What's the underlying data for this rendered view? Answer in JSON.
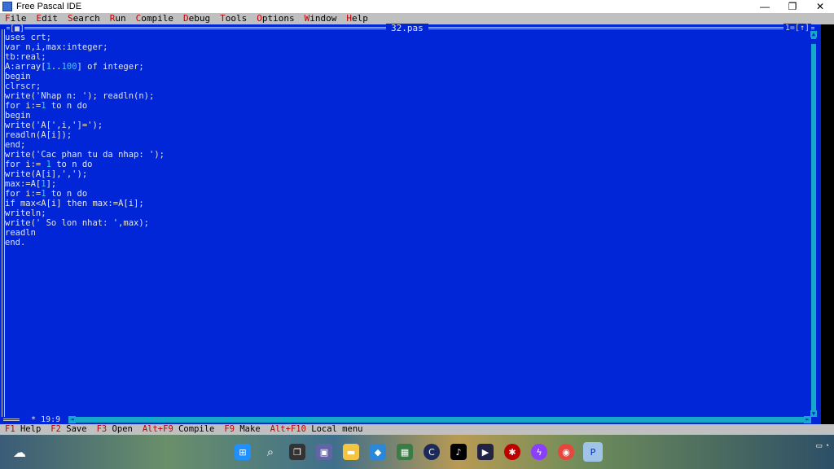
{
  "window": {
    "title": "Free Pascal IDE",
    "minimize": "—",
    "restore": "❐",
    "close": "✕"
  },
  "menu": [
    {
      "hotkey": "F",
      "rest": "ile"
    },
    {
      "hotkey": "E",
      "rest": "dit"
    },
    {
      "hotkey": "S",
      "rest": "earch"
    },
    {
      "hotkey": "R",
      "rest": "un"
    },
    {
      "hotkey": "C",
      "rest": "ompile"
    },
    {
      "hotkey": "D",
      "rest": "ebug"
    },
    {
      "hotkey": "T",
      "rest": "ools"
    },
    {
      "hotkey": "O",
      "rest": "ptions"
    },
    {
      "hotkey": "W",
      "rest": "indow"
    },
    {
      "hotkey": "H",
      "rest": "elp"
    }
  ],
  "editor": {
    "file_name": "32.pas",
    "window_number": "1=[↑]",
    "close_box": "[■]",
    "cursor_position": "19:9",
    "modified_marker": "*",
    "code_lines": [
      "uses crt;",
      "var n,i,max:integer;",
      "tb:real;",
      "A:array[1..100] of integer;",
      "begin",
      "clrscr;",
      "write('Nhap n: '); readln(n);",
      "for i:=1 to n do",
      "begin",
      "write('A[',i,']=');",
      "readln(A[i]);",
      "end;",
      "write('Cac phan tu da nhap: ');",
      "for i:= 1 to n do",
      "write(A[i],',');",
      "max:=A[1];",
      "for i:=1 to n do",
      "if max<A[i] then max:=A[i];",
      "writeln;",
      "write(' So lon nhat: ',max);",
      "readln",
      "end."
    ]
  },
  "status_keys": [
    {
      "key": "F1",
      "label": "Help"
    },
    {
      "key": "F2",
      "label": "Save"
    },
    {
      "key": "F3",
      "label": "Open"
    },
    {
      "key": "Alt+F9",
      "label": "Compile"
    },
    {
      "key": "F9",
      "label": "Make"
    },
    {
      "key": "Alt+F10",
      "label": "Local menu"
    }
  ],
  "colors": {
    "editor_bg": "#0026d8",
    "number_literal": "#3cd0e6",
    "hotkey": "#c00000"
  },
  "taskbar": {
    "icons": [
      "weather-icon",
      "windows-start-icon",
      "search-icon",
      "task-view-icon",
      "teams-icon",
      "file-explorer-icon",
      "photos-icon",
      "app-icon",
      "ccleaner-icon",
      "tiktok-icon",
      "store-icon",
      "antivirus-icon",
      "messenger-icon",
      "chrome-icon",
      "free-pascal-icon"
    ]
  }
}
